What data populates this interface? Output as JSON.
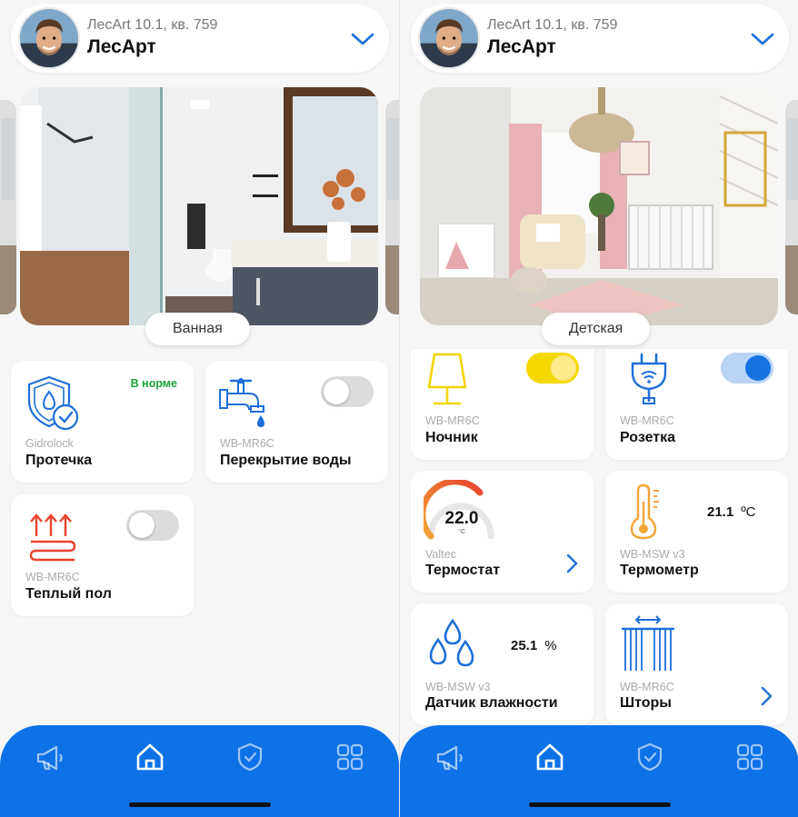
{
  "colors": {
    "accent": "#0d72e8",
    "ok": "#1aa33c",
    "icon_blue": "#1e6fd9",
    "icon_red": "#e8432e",
    "icon_yellow": "#f2d400",
    "icon_orange": "#f3a637"
  },
  "screens": [
    {
      "header": {
        "address": "ЛесArt 10.1, кв. 759",
        "home_name": "ЛесАрт",
        "dropdown_icon": "chevron-down-icon"
      },
      "room": {
        "name": "Ванная"
      },
      "cards": [
        {
          "vendor": "Gidrolock",
          "name": "Протечка",
          "status": "В норме",
          "icon": "leak-shield-icon"
        },
        {
          "vendor": "WB-MR6C",
          "name": "Перекрытие воды",
          "toggle": "off",
          "icon": "water-tap-icon"
        },
        {
          "vendor": "WB-MR6C",
          "name": "Теплый пол",
          "toggle": "off",
          "icon": "floor-heating-icon"
        }
      ]
    },
    {
      "header": {
        "address": "ЛесArt 10.1, кв. 759",
        "home_name": "ЛесАрт",
        "dropdown_icon": "chevron-down-icon"
      },
      "room": {
        "name": "Детская"
      },
      "cards": [
        {
          "vendor": "WB-MR6C",
          "name": "Ночник",
          "toggle": "on",
          "icon": "lamp-icon"
        },
        {
          "vendor": "WB-MR6C",
          "name": "Розетка",
          "toggle": "on",
          "icon": "smart-plug-icon"
        },
        {
          "vendor": "Valtec",
          "name": "Термостат",
          "value": "22.0",
          "unit": "°C",
          "icon": "thermostat-gauge-icon"
        },
        {
          "vendor": "WB-MSW v3",
          "name": "Термометр",
          "value": "21.1",
          "unit": "ºC",
          "icon": "thermometer-icon"
        },
        {
          "vendor": "WB-MSW v3",
          "name": "Датчик влажности",
          "value": "25.1",
          "unit": "%",
          "icon": "humidity-drops-icon"
        },
        {
          "vendor": "WB-MR6C",
          "name": "Шторы",
          "icon": "curtains-icon"
        }
      ]
    }
  ],
  "tabbar": {
    "tabs": [
      "megaphone-icon",
      "home-icon",
      "shield-check-icon",
      "grid-icon"
    ]
  }
}
